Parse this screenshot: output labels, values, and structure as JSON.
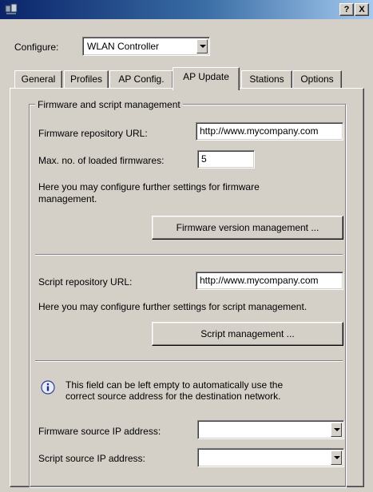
{
  "window": {
    "help_label": "?",
    "close_label": "X"
  },
  "configure": {
    "label": "Configure:",
    "value": "WLAN Controller"
  },
  "tabs": [
    {
      "label": "General"
    },
    {
      "label": "Profiles"
    },
    {
      "label": "AP Config."
    },
    {
      "label": "AP Update"
    },
    {
      "label": "Stations"
    },
    {
      "label": "Options"
    }
  ],
  "active_tab": "AP Update",
  "firmware": {
    "group_title": "Firmware and script management",
    "repo_url_label": "Firmware repository URL:",
    "repo_url_value": "http://www.mycompany.com",
    "max_loaded_label": "Max. no. of loaded firmwares:",
    "max_loaded_value": "5",
    "hint": "Here you may configure further settings for firmware management.",
    "version_mgmt_button": "Firmware version management ..."
  },
  "script": {
    "repo_url_label": "Script repository URL:",
    "repo_url_value": "http://www.mycompany.com",
    "hint": "Here you may configure further settings for script management.",
    "mgmt_button": "Script management ..."
  },
  "source": {
    "info_text": "This field can be left empty to automatically use the correct source address for the destination network.",
    "firmware_ip_label": "Firmware source IP address:",
    "firmware_ip_value": "",
    "script_ip_label": "Script source IP address:",
    "script_ip_value": ""
  }
}
